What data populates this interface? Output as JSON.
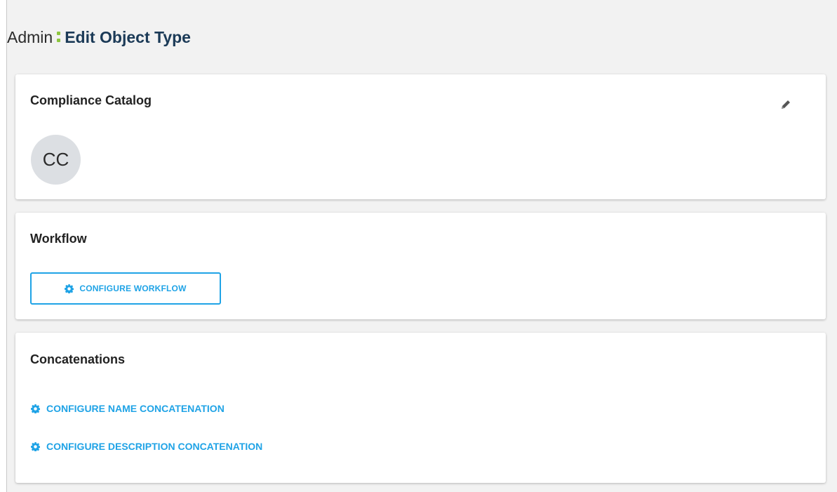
{
  "header": {
    "root": "Admin",
    "page": "Edit Object Type"
  },
  "object_card": {
    "title": "Compliance Catalog",
    "avatar_initials": "CC"
  },
  "workflow_card": {
    "title": "Workflow",
    "configure_button": "CONFIGURE WORKFLOW"
  },
  "concat_card": {
    "title": "Concatenations",
    "name_link": "CONFIGURE NAME CONCATENATION",
    "description_link": "CONFIGURE DESCRIPTION CONCATENATION"
  },
  "colors": {
    "accent": "#1fa3e6",
    "separator": "#8dc63f",
    "title_dark": "#1b3a57"
  },
  "icons": {
    "edit": "pencil-icon",
    "gear": "gear-icon"
  }
}
